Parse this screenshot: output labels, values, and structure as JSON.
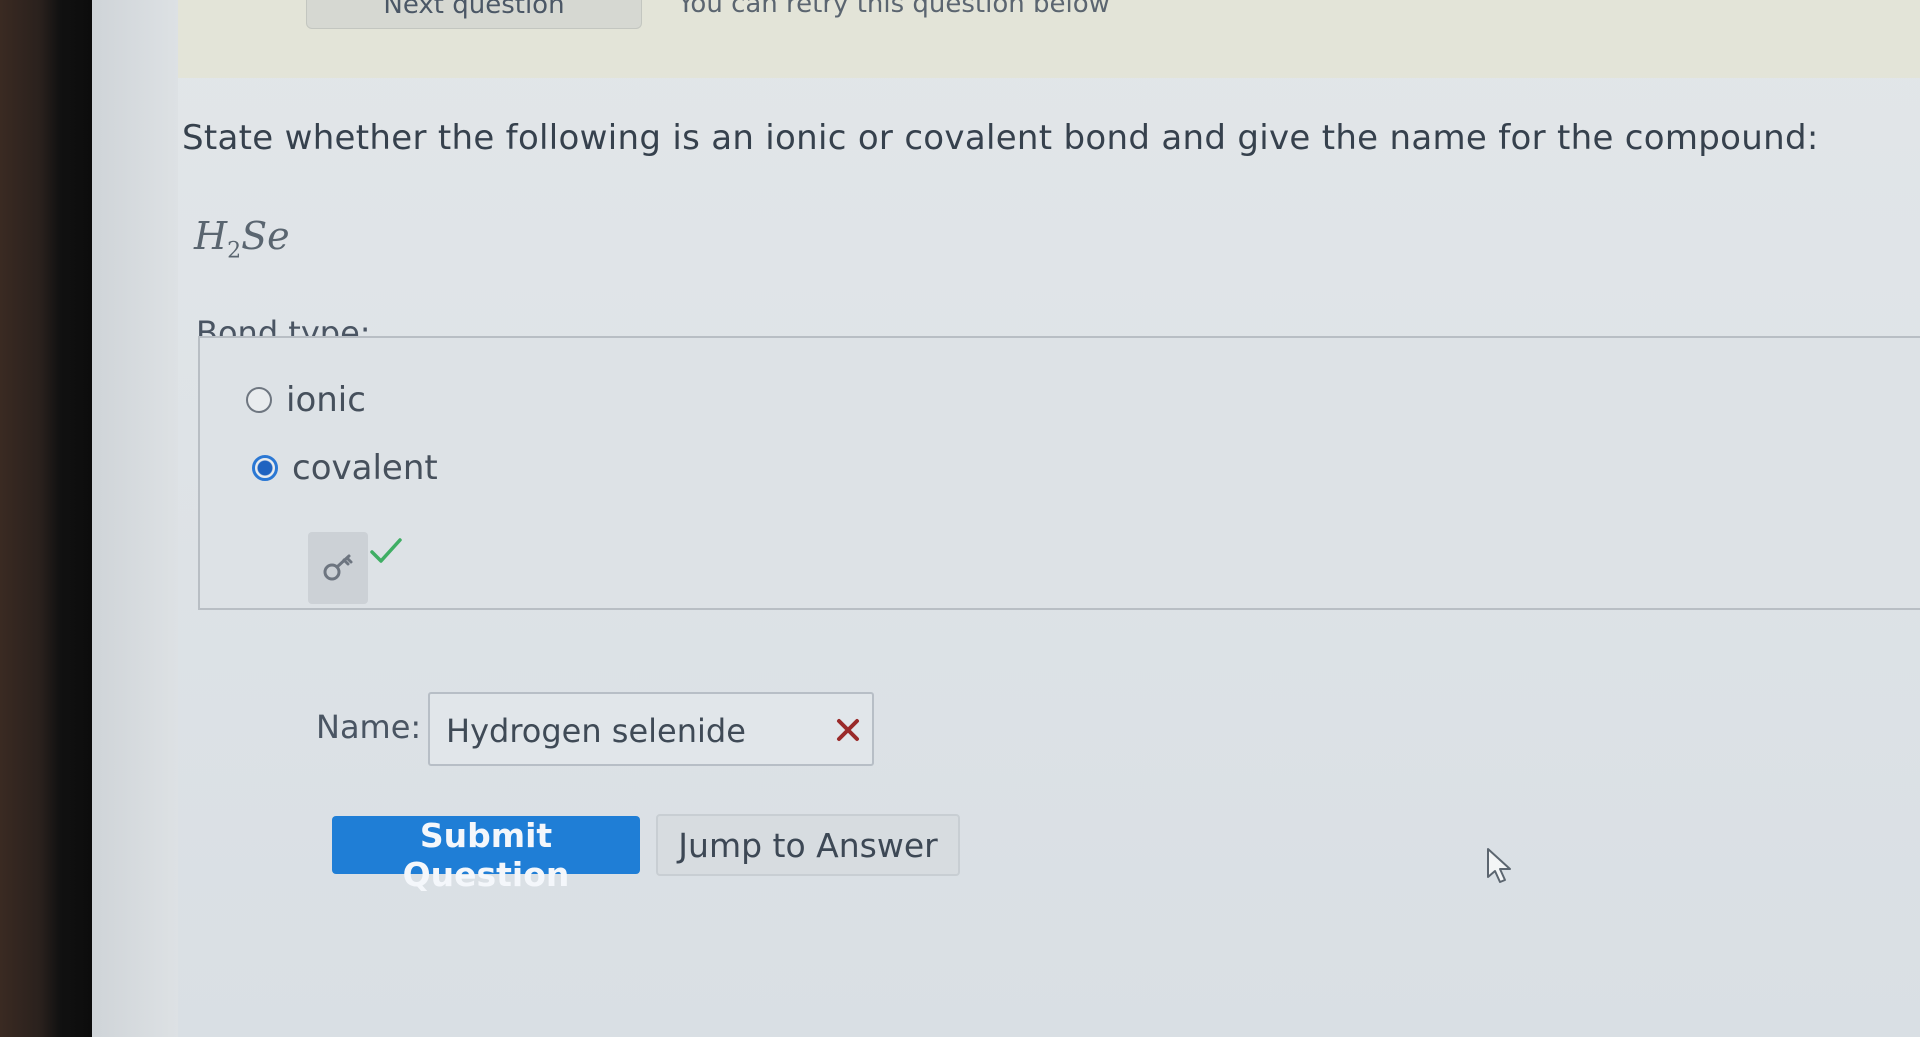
{
  "header": {
    "next_question_label": "Next question",
    "faded_text": "You can retry this question below"
  },
  "question": {
    "prompt": "State whether the following is an ionic or covalent bond and give the name for the compound:",
    "formula_main": "H",
    "formula_sub": "2",
    "formula_rest": "Se"
  },
  "bond_type": {
    "label": "Bond type:",
    "options": [
      {
        "label": "ionic",
        "selected": false
      },
      {
        "label": "covalent",
        "selected": true
      }
    ],
    "key_icon": "key-icon",
    "result_icon": "check-icon",
    "result_color": "#3fae64"
  },
  "name_field": {
    "label": "Name:",
    "value": "Hydrogen selenide",
    "status_icon": "x-icon",
    "status_color": "#9a2a2a"
  },
  "actions": {
    "submit_label": "Submit Question",
    "jump_label": "Jump to Answer"
  },
  "colors": {
    "accent": "#1f7ed6",
    "text": "#36414d"
  }
}
